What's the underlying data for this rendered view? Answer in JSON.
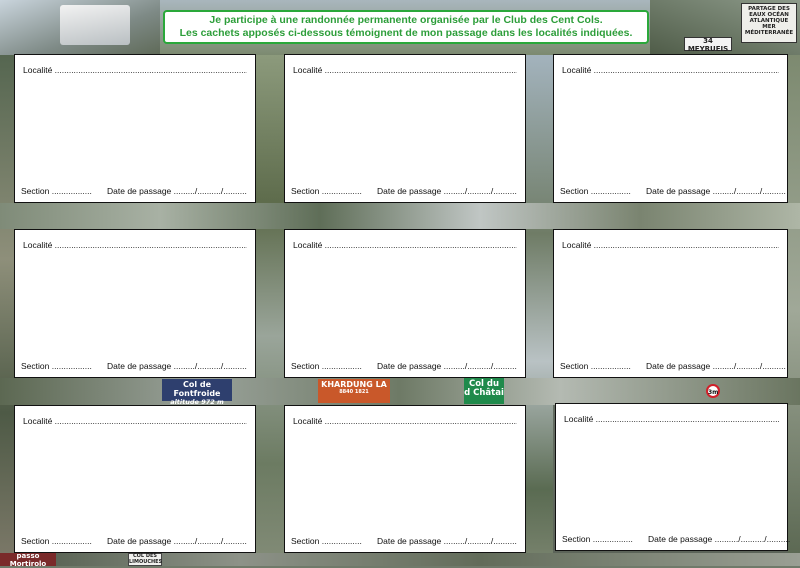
{
  "banner": {
    "line1": "Je participe à une randonnée permanente organisée par le Club des Cent Cols.",
    "line2": "Les cachets apposés ci-dessous témoignent de mon passage dans les localités indiquées."
  },
  "card": {
    "localite": "Localité ...........................................................................................................",
    "section": "Section .................",
    "date": "Date de passage ........./........../..........",
    "section_last": "Section .................",
    "date_last": "Date de passage ........../........../.........."
  },
  "signs": {
    "partage": "PARTAGE DES EAUX OCÉAN ATLANTIQUE MER MÉDITERRANÉE",
    "meyrueis": "34 MEYRUEIS",
    "fontfroide1": "Col de Fontfroide",
    "fontfroide2": "altitude 972 m",
    "khardung1": "KHARDUNG LA",
    "khardung2": "8840 1821",
    "chatai1": "Col du",
    "chatai2": "d Châtai",
    "mortirolo": "passo Mortirolo",
    "limouches": "COL DES LIMOUCHES",
    "roadsign": "3m"
  },
  "colors": {
    "banner_text": "#2d9e3a",
    "banner_border": "#2aa83a",
    "fontfroide_bg": "#2e3f6e",
    "khardung_bg": "#c9582a",
    "chatai_bg": "#1f8a4b"
  }
}
